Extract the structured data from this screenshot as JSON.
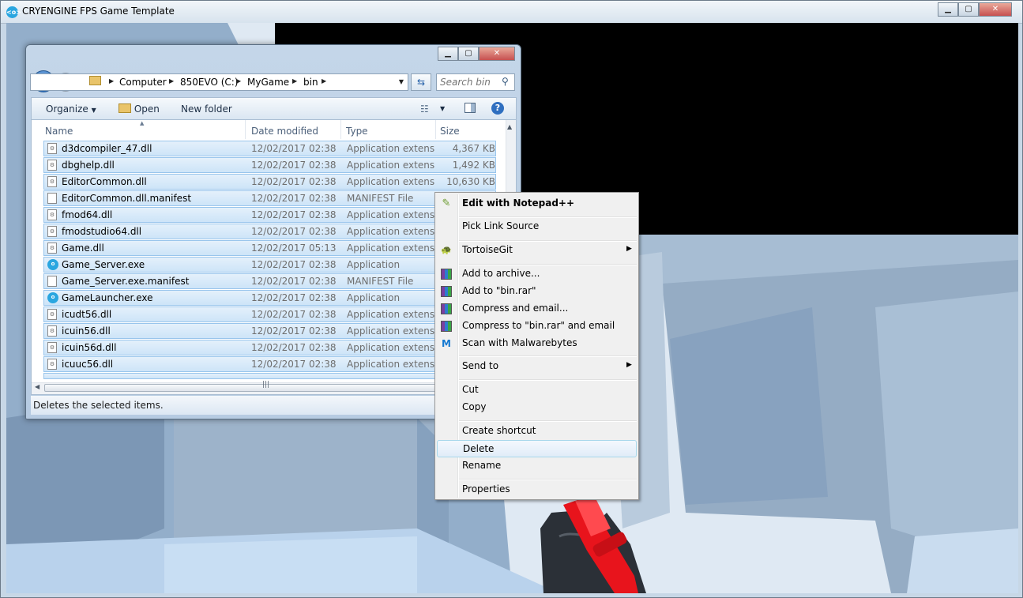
{
  "game_window": {
    "title": "CRYENGINE FPS Game Template",
    "icon": "cryengine-eye-icon"
  },
  "explorer": {
    "breadcrumb": [
      "Computer",
      "850EVO (C:)",
      "MyGame",
      "bin"
    ],
    "search_placeholder": "Search bin",
    "toolbar": {
      "organize": "Organize",
      "open": "Open",
      "new_folder": "New folder"
    },
    "columns": {
      "name": "Name",
      "date": "Date modified",
      "type": "Type",
      "size": "Size"
    },
    "files": [
      {
        "name": "d3dcompiler_47.dll",
        "date": "12/02/2017 02:38",
        "type": "Application extens...",
        "size": "4,367 KB",
        "icon": "dll"
      },
      {
        "name": "dbghelp.dll",
        "date": "12/02/2017 02:38",
        "type": "Application extens...",
        "size": "1,492 KB",
        "icon": "dll"
      },
      {
        "name": "EditorCommon.dll",
        "date": "12/02/2017 02:38",
        "type": "Application extens...",
        "size": "10,630 KB",
        "icon": "dll"
      },
      {
        "name": "EditorCommon.dll.manifest",
        "date": "12/02/2017 02:38",
        "type": "MANIFEST File",
        "size": "",
        "icon": "file"
      },
      {
        "name": "fmod64.dll",
        "date": "12/02/2017 02:38",
        "type": "Application extens...",
        "size": "",
        "icon": "dll"
      },
      {
        "name": "fmodstudio64.dll",
        "date": "12/02/2017 02:38",
        "type": "Application extens...",
        "size": "",
        "icon": "dll"
      },
      {
        "name": "Game.dll",
        "date": "12/02/2017 05:13",
        "type": "Application extens...",
        "size": "",
        "icon": "dll"
      },
      {
        "name": "Game_Server.exe",
        "date": "12/02/2017 02:38",
        "type": "Application",
        "size": "",
        "icon": "exe"
      },
      {
        "name": "Game_Server.exe.manifest",
        "date": "12/02/2017 02:38",
        "type": "MANIFEST File",
        "size": "",
        "icon": "file"
      },
      {
        "name": "GameLauncher.exe",
        "date": "12/02/2017 02:38",
        "type": "Application",
        "size": "",
        "icon": "exe"
      },
      {
        "name": "icudt56.dll",
        "date": "12/02/2017 02:38",
        "type": "Application extens...",
        "size": "",
        "icon": "dll"
      },
      {
        "name": "icuin56.dll",
        "date": "12/02/2017 02:38",
        "type": "Application extens...",
        "size": "",
        "icon": "dll"
      },
      {
        "name": "icuin56d.dll",
        "date": "12/02/2017 02:38",
        "type": "Application extens...",
        "size": "",
        "icon": "dll"
      },
      {
        "name": "icuuc56.dll",
        "date": "12/02/2017 02:38",
        "type": "Application extens...",
        "size": "",
        "icon": "dll"
      }
    ],
    "status": "Deletes the selected items."
  },
  "context_menu": {
    "items": [
      {
        "label": "Edit with Notepad++",
        "bold": true,
        "icon": "notepadpp-icon"
      },
      {
        "label": "Pick Link Source",
        "icon": ""
      },
      {
        "label": "TortoiseGit",
        "icon": "tortoisegit-icon",
        "submenu": true
      },
      {
        "label": "Add to archive...",
        "icon": "winrar-icon"
      },
      {
        "label": "Add to \"bin.rar\"",
        "icon": "winrar-icon"
      },
      {
        "label": "Compress and email...",
        "icon": "winrar-icon"
      },
      {
        "label": "Compress to \"bin.rar\" and email",
        "icon": "winrar-icon"
      },
      {
        "label": "Scan with Malwarebytes",
        "icon": "malwarebytes-icon"
      },
      {
        "label": "Send to",
        "icon": "",
        "submenu": true
      },
      {
        "label": "Cut",
        "icon": ""
      },
      {
        "label": "Copy",
        "icon": ""
      },
      {
        "label": "Create shortcut",
        "icon": ""
      },
      {
        "label": "Delete",
        "icon": "",
        "hovered": true
      },
      {
        "label": "Rename",
        "icon": ""
      },
      {
        "label": "Properties",
        "icon": ""
      }
    ]
  },
  "colors": {
    "selection": "#cde4f8",
    "menu_hover": "#e1ecf8",
    "weapon": "#e8141c",
    "scene_sky": "#000000"
  }
}
